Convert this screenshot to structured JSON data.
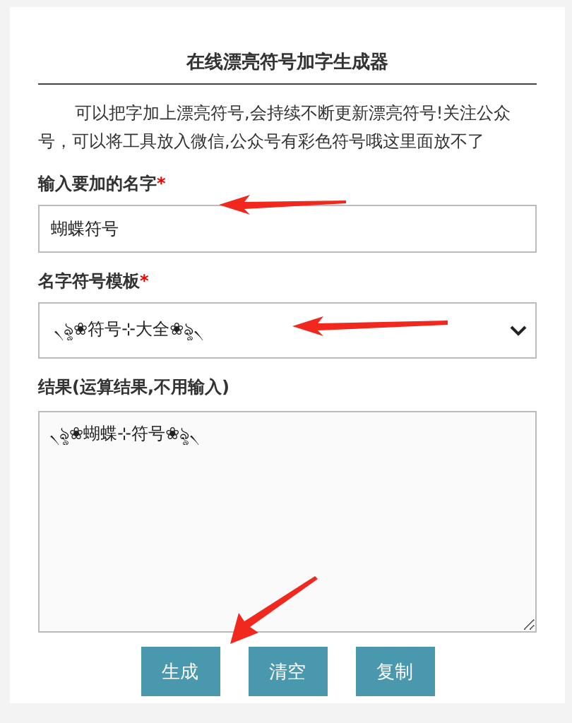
{
  "title": "在线漂亮符号加字生成器",
  "intro": "可以把字加上漂亮符号,会持续不断更新漂亮符号!关注公众号，可以将工具放入微信,公众号有彩色符号哦这里面放不了",
  "name_field": {
    "label": "输入要加的名字",
    "required_mark": "*",
    "value": "蝴蝶符号"
  },
  "template_field": {
    "label": "名字符号模板",
    "required_mark": "*",
    "value": "৲ৡ❀符号⊹大全❀ৡ৲"
  },
  "result_field": {
    "label": "结果(运算结果,不用输入)",
    "value": "৲ৡ❀蝴蝶⊹符号❀ৡ৲"
  },
  "buttons": [
    "生成",
    "清空",
    "复制"
  ]
}
